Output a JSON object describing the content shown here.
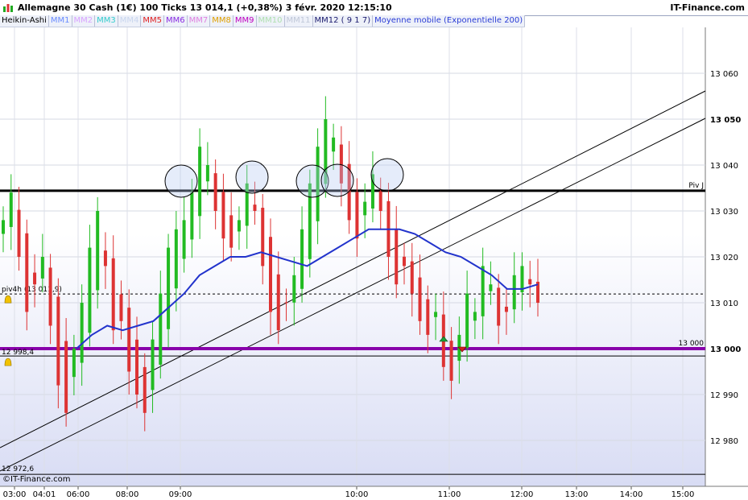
{
  "header": {
    "title": "Allemagne 30 Cash (1€)   100 Ticks   13 014,1 (+0,38%)   3 févr. 2020 12:15:10",
    "brand": "IT-Finance.com"
  },
  "legend": [
    {
      "label": "Heikin-Ashi",
      "color": "#000000"
    },
    {
      "label": "MM1",
      "color": "#6a8cff"
    },
    {
      "label": "MM2",
      "color": "#d9a3ff"
    },
    {
      "label": "MM3",
      "color": "#33cccc"
    },
    {
      "label": "MM4",
      "color": "#c9d6ee"
    },
    {
      "label": "MM5",
      "color": "#e02020"
    },
    {
      "label": "MM6",
      "color": "#8a2be2"
    },
    {
      "label": "MM7",
      "color": "#e080e0"
    },
    {
      "label": "MM8",
      "color": "#e0a000"
    },
    {
      "label": "MM9",
      "color": "#c000c0"
    },
    {
      "label": "MM10",
      "color": "#b0e0b0"
    },
    {
      "label": "MM11",
      "color": "#c0c8d8"
    },
    {
      "label": "MM12 ( 9 1 7)",
      "color": "#1a1a6e"
    },
    {
      "label": "Moyenne mobile (Exponentielle 200)",
      "color": "#2a3cd6"
    }
  ],
  "watermark": "©IT-Finance.com",
  "colors": {
    "up": "#22bb22",
    "down": "#dd3333",
    "ema": "#2233cc",
    "pivot_violet": "#8800aa",
    "bg_top": "#ffffff",
    "bg_bottom": "#d8dcf4"
  },
  "chart_data": {
    "type": "candlestick",
    "instrument": "Allemagne 30 Cash (1€)",
    "timeframe": "100 Ticks",
    "ylim": [
      12970,
      13070
    ],
    "y_ticks": [
      {
        "value": 13060,
        "label": "13 060"
      },
      {
        "value": 13050,
        "label": "13 050",
        "bold": true
      },
      {
        "value": 13040,
        "label": "13 040"
      },
      {
        "value": 13030,
        "label": "13 030"
      },
      {
        "value": 13020,
        "label": "13 020"
      },
      {
        "value": 13010,
        "label": "13 010"
      },
      {
        "value": 13000,
        "label": "13 000",
        "bold": true
      },
      {
        "value": 12990,
        "label": "12 990"
      },
      {
        "value": 12980,
        "label": "12 980"
      }
    ],
    "x_ticks": [
      "03:00",
      "04:01",
      "06:00",
      "08:00",
      "09:00",
      "10:00",
      "11:00",
      "12:00",
      "13:00",
      "14:00",
      "15:00"
    ],
    "levels": [
      {
        "name": "Piv J",
        "value": 13034.4,
        "style": "thick-black"
      },
      {
        "name": "piv4h (13 011,9)",
        "value": 13011.9,
        "style": "dashed"
      },
      {
        "name": "13 000",
        "value": 13000,
        "style": "thick-violet"
      },
      {
        "name": "12 998,4",
        "value": 12998.4,
        "style": "thin-black"
      },
      {
        "name": "12 972,6",
        "value": 12972.6,
        "style": "thin-black"
      }
    ],
    "trend_channel": "two parallel ascending lines",
    "heikin_ashi_closes": [
      13028,
      13034,
      13020,
      13008,
      13014,
      13020,
      13005,
      12992,
      12986,
      13000,
      13010,
      13022,
      13030,
      13018,
      13004,
      13006,
      12995,
      12990,
      12986,
      13002,
      13012,
      13022,
      13026,
      13028,
      13034,
      13044,
      13040,
      13030,
      13024,
      13022,
      13028,
      13036,
      13030,
      13018,
      13008,
      13004,
      13010,
      13016,
      13026,
      13036,
      13044,
      13050,
      13046,
      13036,
      13028,
      13024,
      13032,
      13038,
      13030,
      13020,
      13014,
      13018,
      13012,
      13006,
      13003,
      13008,
      12996,
      12993,
      13003,
      13012,
      13008,
      13018,
      13014,
      13005,
      13008,
      13016,
      13018,
      13014,
      13010
    ],
    "ema200": [
      13000,
      13003,
      13005,
      13004,
      13005,
      13006,
      13009,
      13012,
      13016,
      13018,
      13020,
      13020,
      13021,
      13020,
      13019,
      13018,
      13020,
      13022,
      13024,
      13026,
      13026,
      13026,
      13025,
      13023,
      13021,
      13020,
      13018,
      13016,
      13013,
      13013,
      13014
    ]
  }
}
